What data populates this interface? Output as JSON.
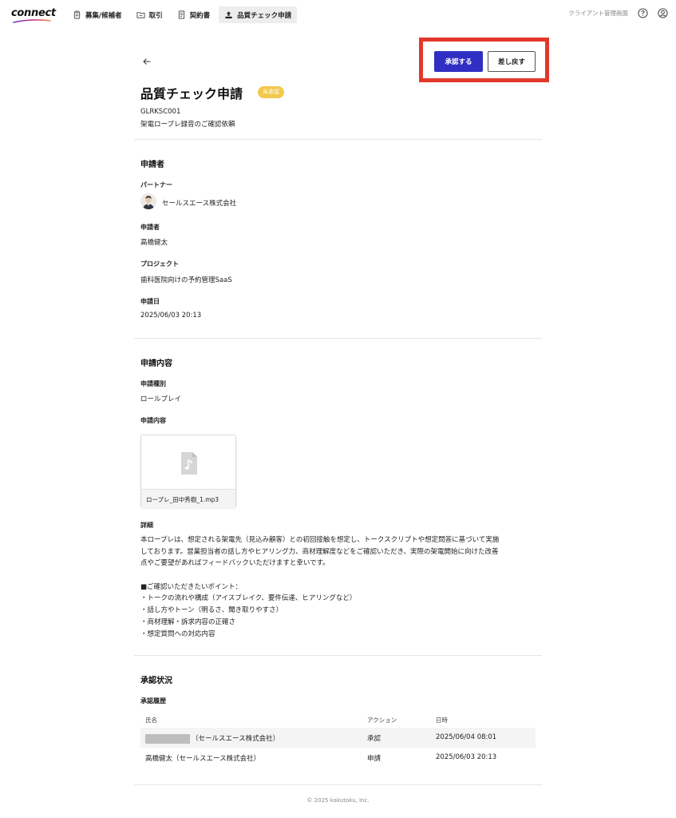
{
  "app": {
    "logo_text": "connect"
  },
  "nav": {
    "items": [
      {
        "label": "募集/候補者",
        "icon": "clipboard-icon"
      },
      {
        "label": "取引",
        "icon": "folder-icon"
      },
      {
        "label": "契約書",
        "icon": "document-icon"
      },
      {
        "label": "品質チェック申請",
        "icon": "upload-icon",
        "active": true
      }
    ],
    "client_link": "クライアント管理画面"
  },
  "header": {
    "approve_label": "承認する",
    "return_label": "差し戻す",
    "title": "品質チェック申請",
    "status": "未承認",
    "code": "GLRKSC001",
    "subtitle": "架電ロープレ録音のご確認依頼"
  },
  "applicant": {
    "section_title": "申請者",
    "partner_label": "パートナー",
    "partner_name": "セールスエース株式会社",
    "applicant_label": "申請者",
    "applicant_name": "高橋健太",
    "project_label": "プロジェクト",
    "project_name": "歯科医院向けの予約管理SaaS",
    "date_label": "申請日",
    "date_value": "2025/06/03 20:13"
  },
  "content": {
    "section_title": "申請内容",
    "type_label": "申請種別",
    "type_value": "ロールプレイ",
    "content_label": "申請内容",
    "file_name": "ロープレ_田中秀樹_1.mp3",
    "detail_label": "詳細",
    "detail_lines": [
      "本ロープレは、想定される架電先（見込み顧客）との初回接触を想定し、トークスクリプトや想定問答に基づいて実施",
      "しております。営業担当者の話し方やヒアリング力、商材理解度などをご確認いただき、実際の架電開始に向けた改善",
      "点やご要望があればフィードバックいただけますと幸いです。",
      "",
      "■ご確認いただきたいポイント：",
      "・トークの流れや構成（アイスブレイク、要件伝達、ヒアリングなど）",
      "・話し方やトーン（明るさ、聞き取りやすさ）",
      "・商材理解・訴求内容の正確さ",
      "・想定質問への対応内容"
    ]
  },
  "approval": {
    "section_title": "承認状況",
    "history_label": "承認履歴",
    "columns": {
      "name": "氏名",
      "action": "アクション",
      "date": "日時"
    },
    "rows": [
      {
        "name": "（セールスエース株式会社）",
        "redacted": true,
        "action": "承認",
        "date": "2025/06/04 08:01"
      },
      {
        "name": "高橋健太（セールスエース株式会社）",
        "redacted": false,
        "action": "申請",
        "date": "2025/06/03 20:13"
      }
    ]
  },
  "footer": {
    "copyright": "© 2025 kakutoku, Inc."
  },
  "colors": {
    "accent": "#2f2fc4",
    "highlight": "#e2382a",
    "badge": "#f2c94c"
  }
}
